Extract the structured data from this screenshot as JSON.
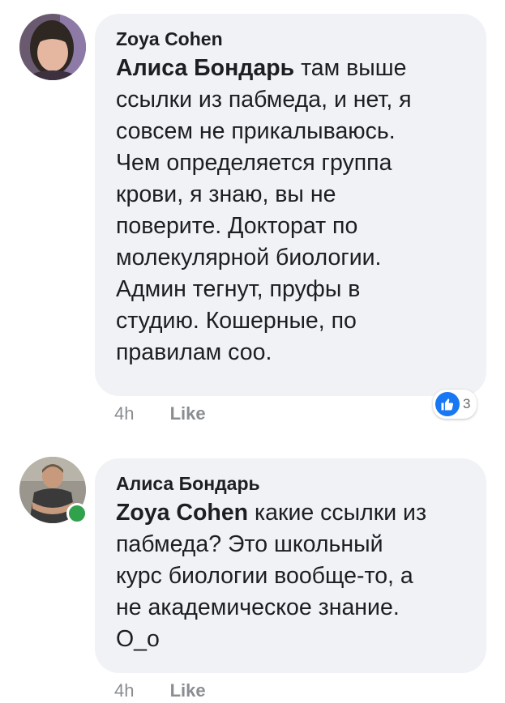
{
  "comments": [
    {
      "author": "Zoya Cohen",
      "mention": "Алиса Бондарь",
      "lines": [
        " там выше",
        "ссылки из пабмеда, и нет, я",
        "совсем не прикалываюсь.",
        "Чем определяется группа",
        "крови, я знаю, вы не",
        "поверите. Докторат по",
        "молекулярной биологии.",
        "Админ тегнут, пруфы в",
        "студию. Кошерные, по",
        "правилам соо."
      ],
      "time": "4h",
      "like_label": "Like",
      "reaction_icon": "thumbs-up-icon",
      "reaction_count": "3"
    },
    {
      "author": "Алиса Бондарь",
      "mention": "Zoya Cohen",
      "lines": [
        " какие ссылки из",
        "пабмеда? Это школьный",
        "курс биологии вообще-то, а",
        "не академическое знание.",
        "O_o"
      ],
      "time": "4h",
      "like_label": "Like",
      "online": true
    }
  ],
  "colors": {
    "bubble": "#f0f2f5",
    "meta": "#8a8d91",
    "online": "#31a24c",
    "like_badge": "#1877f2"
  }
}
